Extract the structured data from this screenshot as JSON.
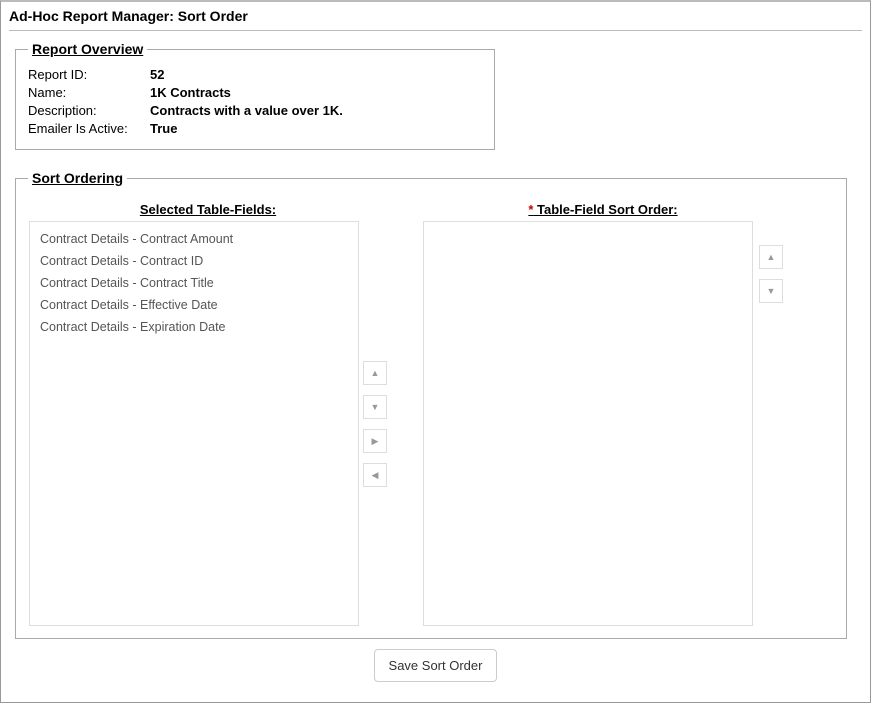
{
  "page_title": "Ad-Hoc Report Manager: Sort Order",
  "overview": {
    "legend": "Report Overview",
    "labels": {
      "report_id": "Report ID:",
      "name": "Name:",
      "description": "Description:",
      "emailer_active": "Emailer Is Active:"
    },
    "values": {
      "report_id": "52",
      "name": "1K Contracts",
      "description": "Contracts with a value over 1K.",
      "emailer_active": "True"
    }
  },
  "sort": {
    "legend": "Sort Ordering",
    "left_header": "Selected Table-Fields:",
    "right_header": "Table-Field Sort Order:",
    "required_marker": "*",
    "available_fields": [
      "Contract Details - Contract Amount",
      "Contract Details - Contract ID",
      "Contract Details - Contract Title",
      "Contract Details - Effective Date",
      "Contract Details - Expiration Date"
    ],
    "selected_fields": []
  },
  "buttons": {
    "save": "Save Sort Order"
  }
}
